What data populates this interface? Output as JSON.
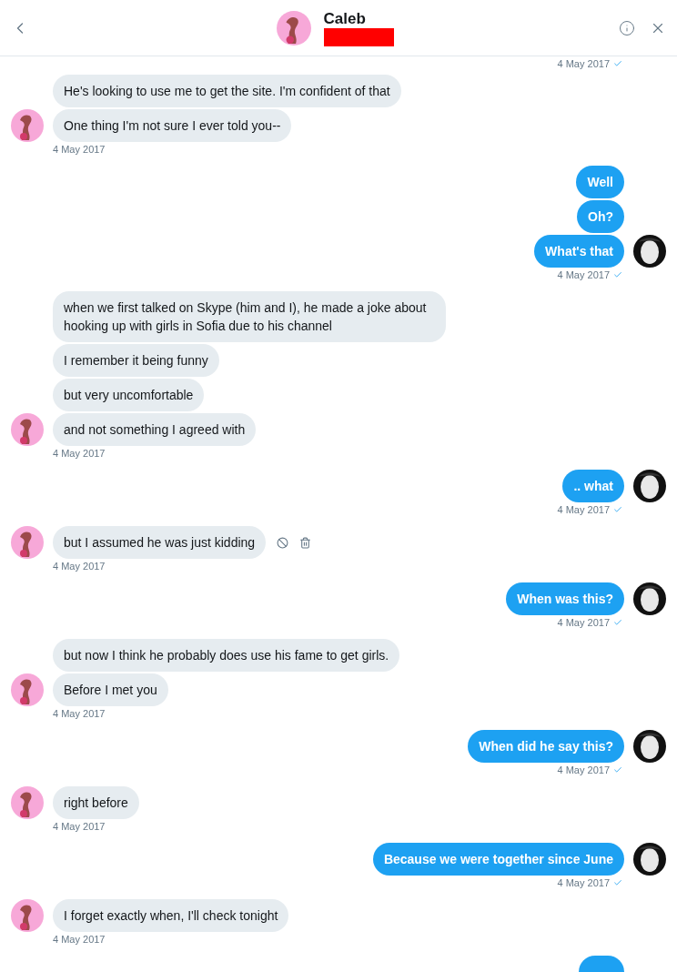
{
  "header": {
    "name": "Caleb",
    "redacted": true
  },
  "groups": [
    {
      "kind": "stamp",
      "stamp": "4 May 2017",
      "read": true
    },
    {
      "kind": "incoming",
      "stamp": "4 May 2017",
      "read": false,
      "messages": [
        {
          "text": "He's looking to use me to get the site. I'm confident of that",
          "actions": false
        },
        {
          "text": "One thing I'm not sure I ever told you--",
          "actions": false
        }
      ]
    },
    {
      "kind": "outgoing",
      "stamp": "4 May 2017",
      "read": true,
      "messages": [
        {
          "text": "Well",
          "actions": false
        },
        {
          "text": "Oh?",
          "actions": false
        },
        {
          "text": "What's that",
          "actions": false
        }
      ]
    },
    {
      "kind": "incoming",
      "stamp": "4 May 2017",
      "read": false,
      "messages": [
        {
          "text": "when we first talked on Skype (him and I), he made a joke about hooking up with girls in Sofia due to his channel",
          "actions": false
        },
        {
          "text": "I remember it being funny",
          "actions": false
        },
        {
          "text": "but very uncomfortable",
          "actions": false
        },
        {
          "text": "and not something I agreed with",
          "actions": false
        }
      ]
    },
    {
      "kind": "outgoing",
      "stamp": "4 May 2017",
      "read": true,
      "messages": [
        {
          "text": ".. what",
          "actions": false
        }
      ]
    },
    {
      "kind": "incoming",
      "stamp": "4 May 2017",
      "read": false,
      "messages": [
        {
          "text": "but I assumed he was just kidding",
          "actions": true
        }
      ]
    },
    {
      "kind": "outgoing",
      "stamp": "4 May 2017",
      "read": true,
      "messages": [
        {
          "text": "When was this?",
          "actions": false
        }
      ]
    },
    {
      "kind": "incoming",
      "stamp": "4 May 2017",
      "read": false,
      "messages": [
        {
          "text": "but now I think he probably does use his fame to get girls.",
          "actions": false
        },
        {
          "text": "Before I met you",
          "actions": false
        }
      ]
    },
    {
      "kind": "outgoing",
      "stamp": "4 May 2017",
      "read": true,
      "messages": [
        {
          "text": "When did he say this?",
          "actions": false
        }
      ]
    },
    {
      "kind": "incoming",
      "stamp": "4 May 2017",
      "read": false,
      "messages": [
        {
          "text": "right before",
          "actions": false
        }
      ]
    },
    {
      "kind": "outgoing",
      "stamp": "4 May 2017",
      "read": true,
      "messages": [
        {
          "text": "Because we were together since June",
          "actions": false
        }
      ]
    },
    {
      "kind": "incoming",
      "stamp": "4 May 2017",
      "read": false,
      "messages": [
        {
          "text": "I forget exactly when, I'll check tonight",
          "actions": false
        }
      ]
    },
    {
      "kind": "edge"
    }
  ]
}
